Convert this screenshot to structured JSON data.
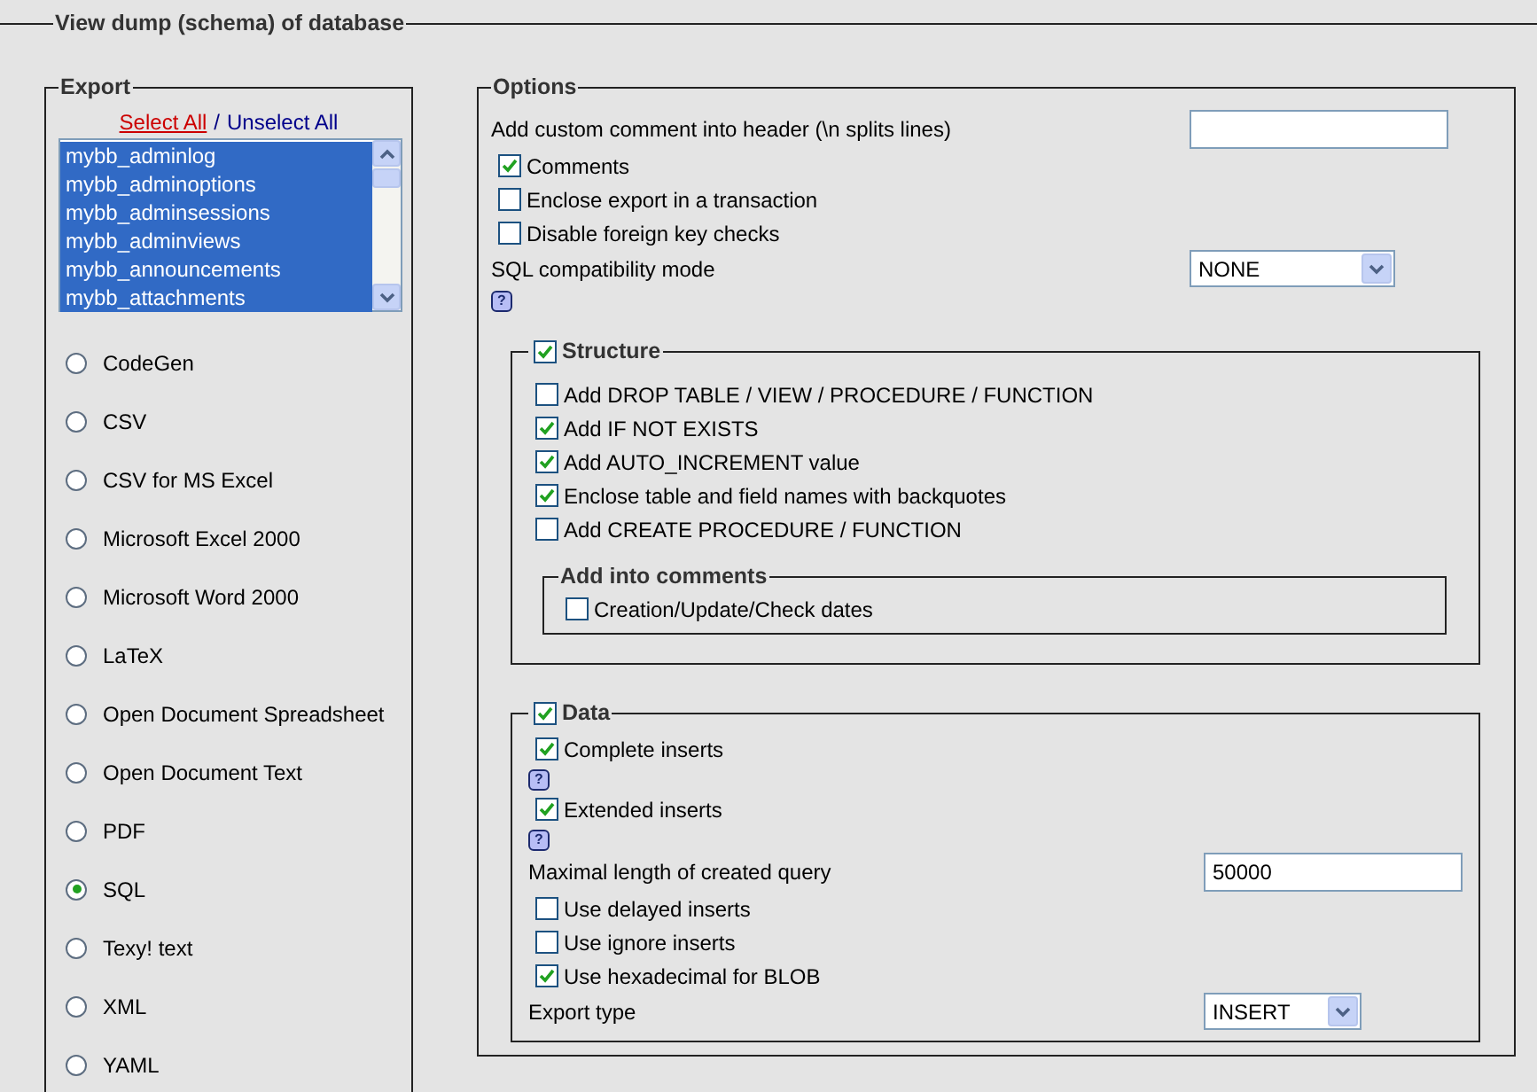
{
  "section": {
    "title": "View dump (schema) of database"
  },
  "export": {
    "title": "Export",
    "select_all": "Select All",
    "separator": "/",
    "unselect_all": "Unselect All",
    "tables": [
      {
        "name": "mybb_adminlog",
        "selected": true
      },
      {
        "name": "mybb_adminoptions",
        "selected": true
      },
      {
        "name": "mybb_adminsessions",
        "selected": true
      },
      {
        "name": "mybb_adminviews",
        "selected": true
      },
      {
        "name": "mybb_announcements",
        "selected": true
      },
      {
        "name": "mybb_attachments",
        "selected": true
      }
    ],
    "formats": [
      {
        "label": "CodeGen",
        "selected": false
      },
      {
        "label": "CSV",
        "selected": false
      },
      {
        "label": "CSV for MS Excel",
        "selected": false
      },
      {
        "label": "Microsoft Excel 2000",
        "selected": false
      },
      {
        "label": "Microsoft Word 2000",
        "selected": false
      },
      {
        "label": "LaTeX",
        "selected": false
      },
      {
        "label": "Open Document Spreadsheet",
        "selected": false
      },
      {
        "label": "Open Document Text",
        "selected": false
      },
      {
        "label": "PDF",
        "selected": false
      },
      {
        "label": "SQL",
        "selected": true
      },
      {
        "label": "Texy! text",
        "selected": false
      },
      {
        "label": "XML",
        "selected": false
      },
      {
        "label": "YAML",
        "selected": false
      }
    ]
  },
  "options": {
    "title": "Options",
    "items": [
      {
        "kind": "text",
        "label": "Add custom comment into header (\\n splits lines)"
      },
      {
        "kind": "checkbox",
        "label": "Comments",
        "checked": true
      },
      {
        "kind": "checkbox",
        "label": "Enclose export in a transaction",
        "checked": false
      },
      {
        "kind": "checkbox",
        "label": "Disable foreign key checks",
        "checked": false
      },
      {
        "kind": "select",
        "label": "SQL compatibility mode",
        "value": "NONE",
        "help": "?"
      }
    ],
    "structure": {
      "title": "Structure",
      "checked": true,
      "items": [
        {
          "label": "Add DROP TABLE / VIEW / PROCEDURE / FUNCTION",
          "checked": false
        },
        {
          "label": "Add IF NOT EXISTS",
          "checked": true
        },
        {
          "label": "Add AUTO_INCREMENT value",
          "checked": true
        },
        {
          "label": "Enclose table and field names with backquotes",
          "checked": true
        },
        {
          "label": "Add CREATE PROCEDURE / FUNCTION",
          "checked": false
        }
      ],
      "comments": {
        "title": "Add into comments",
        "items": [
          {
            "label": "Creation/Update/Check dates",
            "checked": false
          }
        ]
      }
    },
    "data": {
      "title": "Data",
      "checked": true,
      "items": [
        {
          "kind": "checkbox",
          "label": "Complete inserts",
          "checked": true,
          "help": "?"
        },
        {
          "kind": "checkbox",
          "label": "Extended inserts",
          "checked": true,
          "help": "?"
        },
        {
          "kind": "text",
          "label": "Maximal length of created query",
          "value": "50000"
        },
        {
          "kind": "checkbox",
          "label": "Use delayed inserts",
          "checked": false
        },
        {
          "kind": "checkbox",
          "label": "Use ignore inserts",
          "checked": false
        },
        {
          "kind": "checkbox",
          "label": "Use hexadecimal for BLOB",
          "checked": true
        },
        {
          "kind": "select",
          "label": "Export type",
          "value": "INSERT"
        }
      ]
    }
  }
}
